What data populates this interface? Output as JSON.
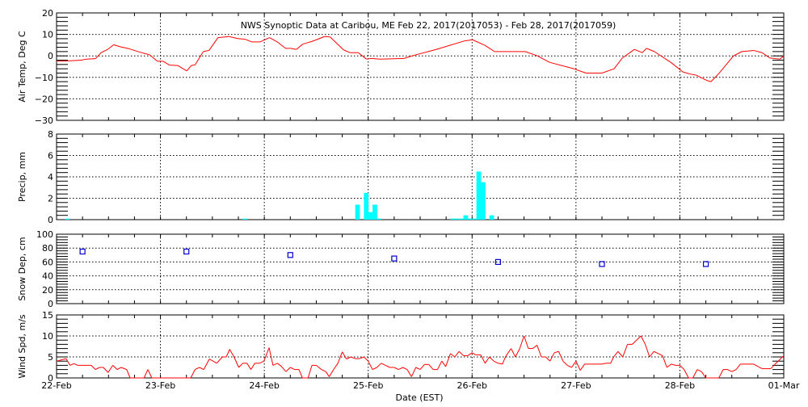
{
  "title": "NWS Synoptic Data at Caribou, ME   Feb 22, 2017(2017053) - Feb 28, 2017(2017059)",
  "xlabel": "Date (EST)",
  "x_tick_labels": [
    "22-Feb",
    "23-Feb",
    "24-Feb",
    "25-Feb",
    "26-Feb",
    "27-Feb",
    "28-Feb",
    "01-Mar"
  ],
  "colors": {
    "temp": "#ff0000",
    "precip": "#00ffff",
    "snow": "#0000cc",
    "wind": "#ff0000"
  },
  "chart_data": [
    {
      "type": "line",
      "ylabel": "Air Temp, Deg C",
      "ylim": [
        -30,
        20
      ],
      "yticks": [
        20,
        10,
        0,
        -10,
        -20,
        -30
      ],
      "y_tick_labels": [
        "20",
        "10",
        "0",
        "−10",
        "−20",
        "−30"
      ],
      "x_unit": "hours since 22-Feb 00:00",
      "points": [
        [
          0,
          -2.4
        ],
        [
          1.9,
          -2.4
        ],
        [
          5.7,
          -2
        ],
        [
          6.9,
          -1.5
        ],
        [
          9,
          -1.3
        ],
        [
          10.3,
          1.5
        ],
        [
          11.8,
          3
        ],
        [
          13.2,
          5.2
        ],
        [
          14.6,
          4.3
        ],
        [
          16.8,
          3.3
        ],
        [
          19.3,
          1.7
        ],
        [
          21.5,
          0.5
        ],
        [
          23.3,
          -2.5
        ],
        [
          24.6,
          -2.5
        ],
        [
          26.1,
          -4.3
        ],
        [
          28,
          -4.5
        ],
        [
          30.1,
          -7
        ],
        [
          31.1,
          -4.5
        ],
        [
          32,
          -4.2
        ],
        [
          33.9,
          2
        ],
        [
          35.2,
          2.5
        ],
        [
          37.3,
          8.5
        ],
        [
          39.8,
          9
        ],
        [
          42,
          8
        ],
        [
          43.5,
          7.8
        ],
        [
          45.1,
          6.5
        ],
        [
          47,
          6.5
        ],
        [
          49.2,
          8.5
        ],
        [
          51,
          6.5
        ],
        [
          52.9,
          3.5
        ],
        [
          54.1,
          3.5
        ],
        [
          55.4,
          3
        ],
        [
          56.9,
          5.5
        ],
        [
          59.1,
          6.8
        ],
        [
          61.9,
          9
        ],
        [
          63.2,
          8.8
        ],
        [
          66.3,
          2.8
        ],
        [
          67.8,
          1.5
        ],
        [
          69.7,
          1.5
        ],
        [
          71.6,
          -1.5
        ],
        [
          72.8,
          -1.2
        ],
        [
          74.7,
          -1.5
        ],
        [
          80.3,
          -1.2
        ],
        [
          82.1,
          0
        ],
        [
          87.7,
          3
        ],
        [
          94.3,
          7
        ],
        [
          96.1,
          7.5
        ],
        [
          98.9,
          5
        ],
        [
          101.2,
          2
        ],
        [
          108.3,
          2
        ],
        [
          111.1,
          0
        ],
        [
          113.9,
          -3
        ],
        [
          119.5,
          -6
        ],
        [
          122.3,
          -8
        ],
        [
          126,
          -8
        ],
        [
          128.8,
          -6
        ],
        [
          130.7,
          -1
        ],
        [
          133.5,
          3
        ],
        [
          135.3,
          1.5
        ],
        [
          136.3,
          3.5
        ],
        [
          138.1,
          2
        ],
        [
          141.9,
          -3
        ],
        [
          144.7,
          -7.5
        ],
        [
          146.5,
          -8.5
        ],
        [
          147.8,
          -9
        ],
        [
          150.3,
          -11.5
        ],
        [
          151.2,
          -12
        ],
        [
          153.1,
          -8
        ],
        [
          156.4,
          0
        ],
        [
          158.3,
          2
        ],
        [
          161.1,
          2.5
        ],
        [
          163,
          1.5
        ],
        [
          164.8,
          -1
        ],
        [
          167.1,
          -1.5
        ],
        [
          168,
          0
        ]
      ]
    },
    {
      "type": "bar",
      "ylabel": "Precip, mm",
      "ylim": [
        0,
        8
      ],
      "yticks": [
        0,
        2,
        4,
        6,
        8
      ],
      "y_tick_labels": [
        "0",
        "2",
        "4",
        "6",
        "8"
      ],
      "x_unit": "hour bins since 22-Feb 00:00",
      "bars": [
        [
          2,
          0.1
        ],
        [
          43,
          0.1
        ],
        [
          69,
          1.4
        ],
        [
          71,
          2.5
        ],
        [
          72,
          0.7
        ],
        [
          73,
          1.4
        ],
        [
          74,
          0.1
        ],
        [
          91,
          0.1
        ],
        [
          92,
          0.1
        ],
        [
          93,
          0.1
        ],
        [
          94,
          0.4
        ],
        [
          95,
          0.1
        ],
        [
          96,
          0.1
        ],
        [
          97,
          4.5
        ],
        [
          98,
          3.5
        ],
        [
          100,
          0.4
        ]
      ]
    },
    {
      "type": "scatter",
      "ylabel": "Snow Dep, cm",
      "ylim": [
        0,
        100
      ],
      "yticks": [
        0,
        20,
        40,
        60,
        80,
        100
      ],
      "y_tick_labels": [
        "0",
        "20",
        "40",
        "60",
        "80",
        "100"
      ],
      "x_unit": "hours since 22-Feb 00:00",
      "points": [
        [
          6,
          75
        ],
        [
          30,
          75
        ],
        [
          54,
          70
        ],
        [
          78,
          65
        ],
        [
          102,
          60
        ],
        [
          126,
          57
        ],
        [
          150,
          57
        ]
      ]
    },
    {
      "type": "line",
      "ylabel": "Wind Spd, m/s",
      "ylim": [
        0,
        15
      ],
      "yticks": [
        0,
        5,
        10,
        15
      ],
      "y_tick_labels": [
        "0",
        "5",
        "10",
        "15"
      ],
      "x_unit": "hours since 22-Feb 00:00",
      "points": [
        [
          0,
          4
        ],
        [
          2.2,
          4.6
        ],
        [
          3.1,
          3
        ],
        [
          4,
          3.4
        ],
        [
          4.9,
          3
        ],
        [
          8,
          3
        ],
        [
          9,
          2
        ],
        [
          9.9,
          2.5
        ],
        [
          10.8,
          2.5
        ],
        [
          11.9,
          1.3
        ],
        [
          13,
          3
        ],
        [
          14,
          2
        ],
        [
          14.9,
          2.5
        ],
        [
          16.2,
          2
        ],
        [
          17,
          0
        ],
        [
          20.2,
          0
        ],
        [
          21.1,
          2
        ],
        [
          22,
          0
        ],
        [
          31,
          0
        ],
        [
          32,
          2
        ],
        [
          33,
          2.5
        ],
        [
          34,
          2
        ],
        [
          35.3,
          4.5
        ],
        [
          37,
          3.5
        ],
        [
          38.3,
          5
        ],
        [
          39.2,
          5
        ],
        [
          40,
          6.8
        ],
        [
          41,
          5
        ],
        [
          42.1,
          2.5
        ],
        [
          43,
          3.5
        ],
        [
          44,
          3.5
        ],
        [
          44.9,
          2
        ],
        [
          45.8,
          3.5
        ],
        [
          46.9,
          3.5
        ],
        [
          47.9,
          4
        ],
        [
          49.1,
          7.2
        ],
        [
          50,
          3
        ],
        [
          51,
          3.5
        ],
        [
          51.9,
          2.8
        ],
        [
          53,
          1.5
        ],
        [
          54,
          2.5
        ],
        [
          55,
          2
        ],
        [
          56,
          2
        ],
        [
          56.8,
          0
        ],
        [
          58.1,
          0
        ],
        [
          59,
          3
        ],
        [
          60,
          3
        ],
        [
          61.2,
          2
        ],
        [
          62.2,
          1.5
        ],
        [
          63,
          0.3
        ],
        [
          64,
          2
        ],
        [
          65,
          3.5
        ],
        [
          66,
          6.2
        ],
        [
          67,
          4.5
        ],
        [
          68,
          5
        ],
        [
          69,
          4.6
        ],
        [
          70,
          4.6
        ],
        [
          71,
          5
        ],
        [
          72,
          4
        ],
        [
          73,
          2
        ],
        [
          74,
          2.5
        ],
        [
          75,
          3.5
        ],
        [
          76,
          3
        ],
        [
          77,
          2.5
        ],
        [
          78,
          2.5
        ],
        [
          79,
          2
        ],
        [
          80,
          2.5
        ],
        [
          81,
          2
        ],
        [
          82,
          0.3
        ],
        [
          83,
          2.5
        ],
        [
          84,
          2
        ],
        [
          85,
          3.2
        ],
        [
          86,
          3.2
        ],
        [
          87,
          2
        ],
        [
          88,
          2
        ],
        [
          89,
          4
        ],
        [
          89.9,
          2.7
        ],
        [
          91,
          5.8
        ],
        [
          92,
          5
        ],
        [
          93,
          6.3
        ],
        [
          94,
          5.3
        ],
        [
          95,
          5.3
        ],
        [
          96,
          6
        ],
        [
          96.8,
          5.5
        ],
        [
          98,
          5.5
        ],
        [
          99,
          3.5
        ],
        [
          100,
          5
        ],
        [
          101,
          4
        ],
        [
          102,
          3.5
        ],
        [
          103,
          3.3
        ],
        [
          103.8,
          5.2
        ],
        [
          105,
          7
        ],
        [
          106,
          5
        ],
        [
          107,
          7
        ],
        [
          108,
          10
        ],
        [
          109,
          7
        ],
        [
          110,
          7
        ],
        [
          111,
          7.8
        ],
        [
          112,
          5
        ],
        [
          113,
          5
        ],
        [
          114,
          4
        ],
        [
          115,
          6
        ],
        [
          116,
          6.3
        ],
        [
          117,
          4
        ],
        [
          118,
          3
        ],
        [
          119,
          2.5
        ],
        [
          120,
          4
        ],
        [
          121,
          1.8
        ],
        [
          122,
          3.3
        ],
        [
          126,
          3.3
        ],
        [
          127,
          3.5
        ],
        [
          128,
          3.5
        ],
        [
          128.7,
          5
        ],
        [
          129.7,
          6.3
        ],
        [
          130.8,
          5
        ],
        [
          131.9,
          8
        ],
        [
          133,
          8
        ],
        [
          135,
          10
        ],
        [
          136,
          8
        ],
        [
          137,
          5
        ],
        [
          138,
          6.3
        ],
        [
          139,
          5.8
        ],
        [
          140,
          5.3
        ],
        [
          141,
          2.5
        ],
        [
          142,
          3.3
        ],
        [
          143,
          3
        ],
        [
          144,
          3
        ],
        [
          145,
          2
        ],
        [
          146,
          0
        ],
        [
          147,
          0
        ],
        [
          148,
          2
        ],
        [
          149,
          1.5
        ],
        [
          150,
          0
        ],
        [
          153,
          0
        ],
        [
          154,
          2
        ],
        [
          155,
          2
        ],
        [
          156,
          1.5
        ],
        [
          157,
          2
        ],
        [
          158,
          3.3
        ],
        [
          161,
          3.3
        ],
        [
          163,
          2.2
        ],
        [
          165,
          2.2
        ],
        [
          166,
          3.3
        ],
        [
          168,
          5.3
        ]
      ]
    }
  ]
}
